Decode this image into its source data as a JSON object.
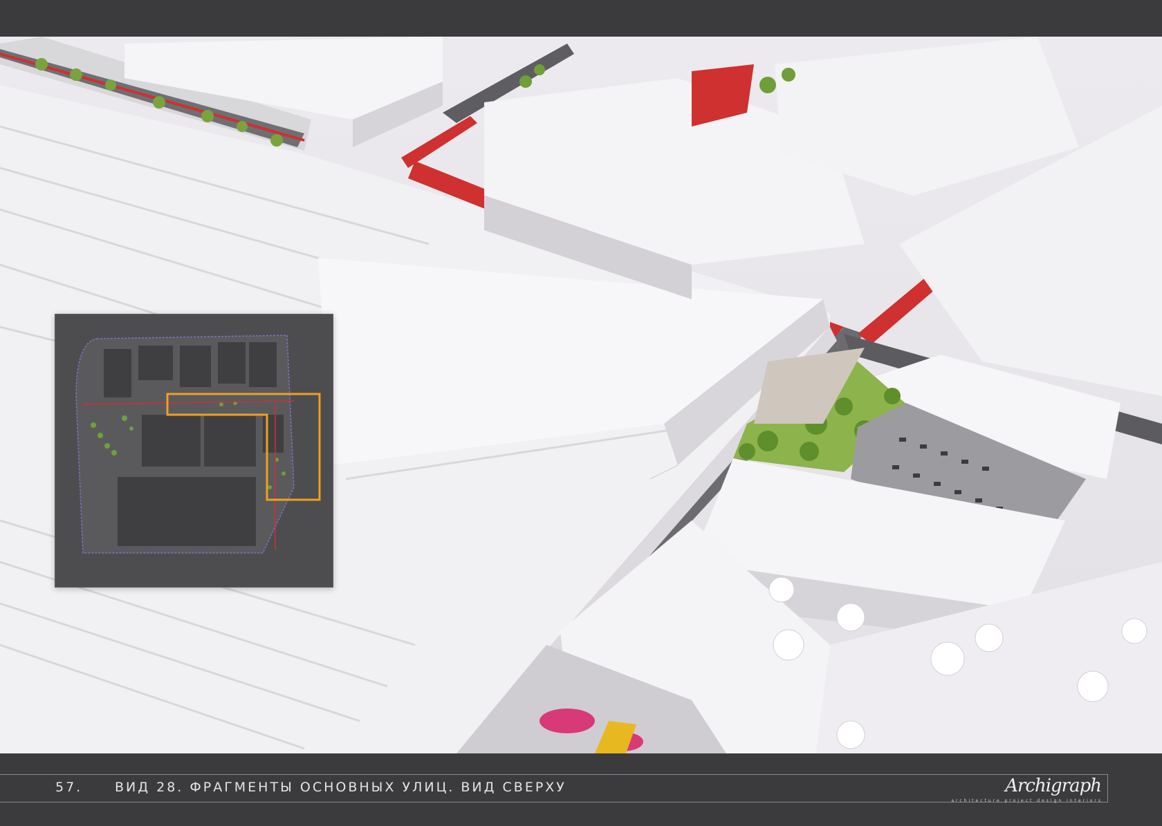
{
  "footer": {
    "page_number": "57.",
    "caption": "ВИД 28. ФРАГМЕНТЫ ОСНОВНЫХ УЛИЦ. ВИД СВЕРХУ",
    "logo_signature": "Archigraph",
    "logo_tagline": "architecture  project  design  interiors"
  },
  "colors": {
    "frame_background": "#3b3b3d",
    "building_white": "#f4f3f5",
    "bike_lane_red": "#cf3030",
    "greenery": "#6f9e3a",
    "highlight_orange": "#f0a020"
  },
  "icons": [
    "site-plan-minimap",
    "aerial-render",
    "archigraph-logo"
  ]
}
